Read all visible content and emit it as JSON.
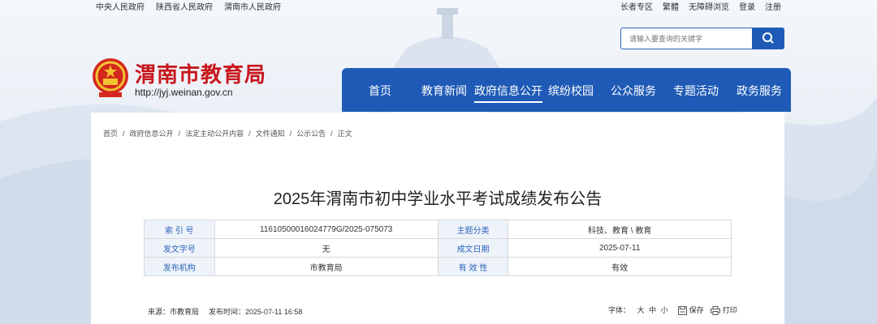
{
  "top_links": [
    "中央人民政府",
    "陕西省人民政府",
    "渭南市人民政府"
  ],
  "right_links": [
    "长者专区",
    "繁體",
    "无障碍浏览",
    "登录",
    "注册"
  ],
  "search": {
    "placeholder": "请输入要查询的关键字",
    "icon": "search-icon"
  },
  "site": {
    "title": "渭南市教育局",
    "url": "http://jyj.weinan.gov.cn"
  },
  "nav": {
    "items": [
      "首页",
      "教育新闻",
      "政府信息公开",
      "缤纷校园",
      "公众服务",
      "专题活动",
      "政务服务"
    ],
    "active": "政府信息公开"
  },
  "breadcrumb": [
    "首页",
    "政府信息公开",
    "法定主动公开内容",
    "文件通知",
    "公示公告",
    "正文"
  ],
  "article": {
    "title": "2025年渭南市初中学业水平考试成绩发布公告",
    "meta": [
      [
        "索 引 号",
        "11610500016024779G/2025-075073",
        "主题分类",
        "科技、教育 \\ 教育"
      ],
      [
        "发文字号",
        "无",
        "成文日期",
        "2025-07-11"
      ],
      [
        "发布机构",
        "市教育局",
        "有 效 性",
        "有效"
      ]
    ],
    "source_label": "来源：市教育局",
    "publish_label": "发布时间：2025-07-11 16:58",
    "font_label": "字体：",
    "font_sizes": [
      "大",
      "中",
      "小"
    ],
    "save_label": "保存",
    "print_label": "打印"
  },
  "colors": {
    "primary": "#1f5bb6",
    "brand_red": "#c8161d"
  }
}
